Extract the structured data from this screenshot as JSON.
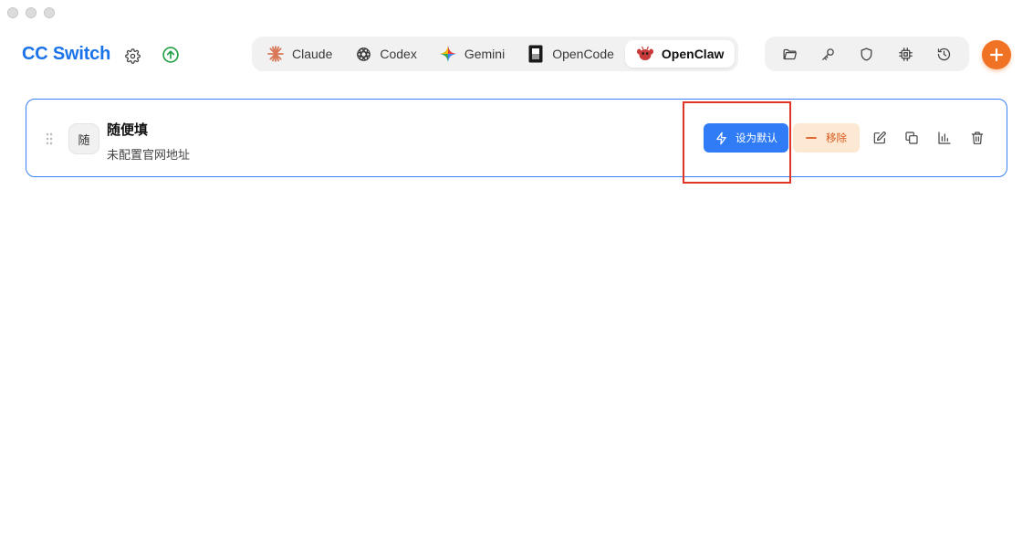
{
  "app": {
    "title": "CC Switch"
  },
  "tabs": [
    {
      "label": "Claude",
      "icon": "claude-icon",
      "active": false
    },
    {
      "label": "Codex",
      "icon": "codex-icon",
      "active": false
    },
    {
      "label": "Gemini",
      "icon": "gemini-icon",
      "active": false
    },
    {
      "label": "OpenCode",
      "icon": "opencode-icon",
      "active": false
    },
    {
      "label": "OpenClaw",
      "icon": "openclaw-icon",
      "active": true
    }
  ],
  "tools": [
    "folder-icon",
    "key-icon",
    "shield-icon",
    "chip-icon",
    "history-icon"
  ],
  "provider": {
    "avatar": "随",
    "name": "随便填",
    "url": "未配置官网地址",
    "set_default_label": "设为默认",
    "remove_label": "移除"
  },
  "colors": {
    "brand": "#1a73e8",
    "accent_orange": "#f07224",
    "primary_button": "#2f7cf6",
    "remove_bg": "#fde9d3",
    "remove_text": "#d9591d",
    "card_border": "#3b82f6",
    "highlight": "#e03426"
  }
}
